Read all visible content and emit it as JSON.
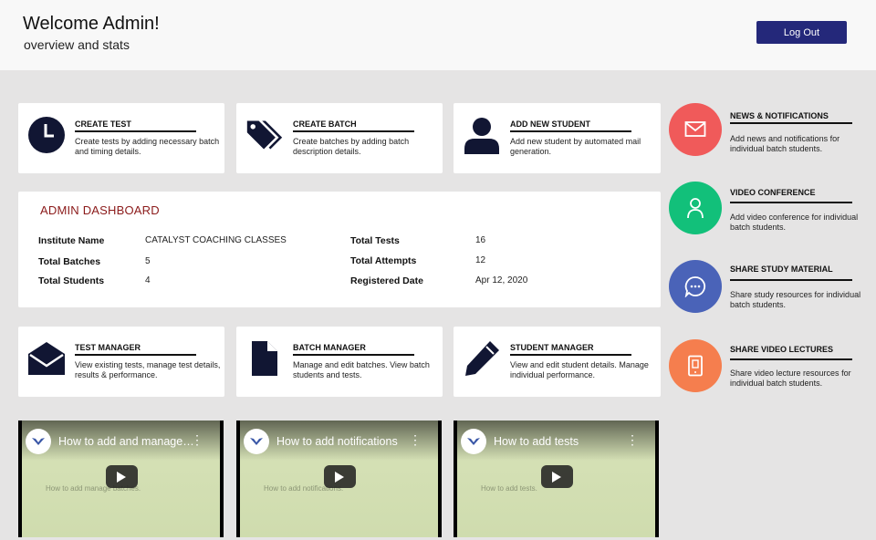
{
  "header": {
    "title": "Welcome Admin!",
    "subtitle": "overview and stats",
    "logout_label": "Log Out"
  },
  "actions": [
    {
      "title": "CREATE TEST",
      "desc": "Create tests by adding necessary batch and timing details.",
      "icon": "clock-icon"
    },
    {
      "title": "CREATE BATCH",
      "desc": "Create batches by adding batch description details.",
      "icon": "tags-icon"
    },
    {
      "title": "ADD NEW STUDENT",
      "desc": "Add new student by automated mail generation.",
      "icon": "user-icon"
    }
  ],
  "dashboard": {
    "title": "ADMIN DASHBOARD",
    "institute_label": "Institute Name",
    "institute_value": "CATALYST COACHING CLASSES",
    "batches_label": "Total Batches",
    "batches_value": "5",
    "students_label": "Total Students",
    "students_value": "4",
    "tests_label": "Total Tests",
    "tests_value": "16",
    "attempts_label": "Total Attempts",
    "attempts_value": "12",
    "registered_label": "Registered Date",
    "registered_value": "Apr 12, 2020"
  },
  "managers": [
    {
      "title": "TEST MANAGER",
      "desc": "View existing tests, manage test details, results & performance.",
      "icon": "envelope-icon"
    },
    {
      "title": "BATCH MANAGER",
      "desc": "Manage and edit batches. View batch students and tests.",
      "icon": "file-icon"
    },
    {
      "title": "STUDENT MANAGER",
      "desc": "View and edit student details. Manage individual performance.",
      "icon": "pencil-icon"
    }
  ],
  "sidebar": [
    {
      "title": "NEWS & NOTIFICATIONS",
      "desc": "Add news and notifications for individual batch students.",
      "color": "#f05a5a",
      "icon": "mail-icon"
    },
    {
      "title": "VIDEO CONFERENCE",
      "desc": "Add video conference for individual batch students.",
      "color": "#12c07a",
      "icon": "person-icon"
    },
    {
      "title": "SHARE STUDY MATERIAL",
      "desc": "Share study resources for individual batch students.",
      "color": "#4a63b8",
      "icon": "chat-icon"
    },
    {
      "title": "SHARE VIDEO LECTURES",
      "desc": "Share video lecture resources for individual batch students.",
      "color": "#f57e4e",
      "icon": "tablet-icon"
    }
  ],
  "videos": [
    {
      "title": "How to add and manage batches",
      "faint": "How to add manage batches."
    },
    {
      "title": "How to add notifications",
      "faint": "How to add notifications."
    },
    {
      "title": "How to add tests",
      "faint": "How to add tests."
    }
  ]
}
